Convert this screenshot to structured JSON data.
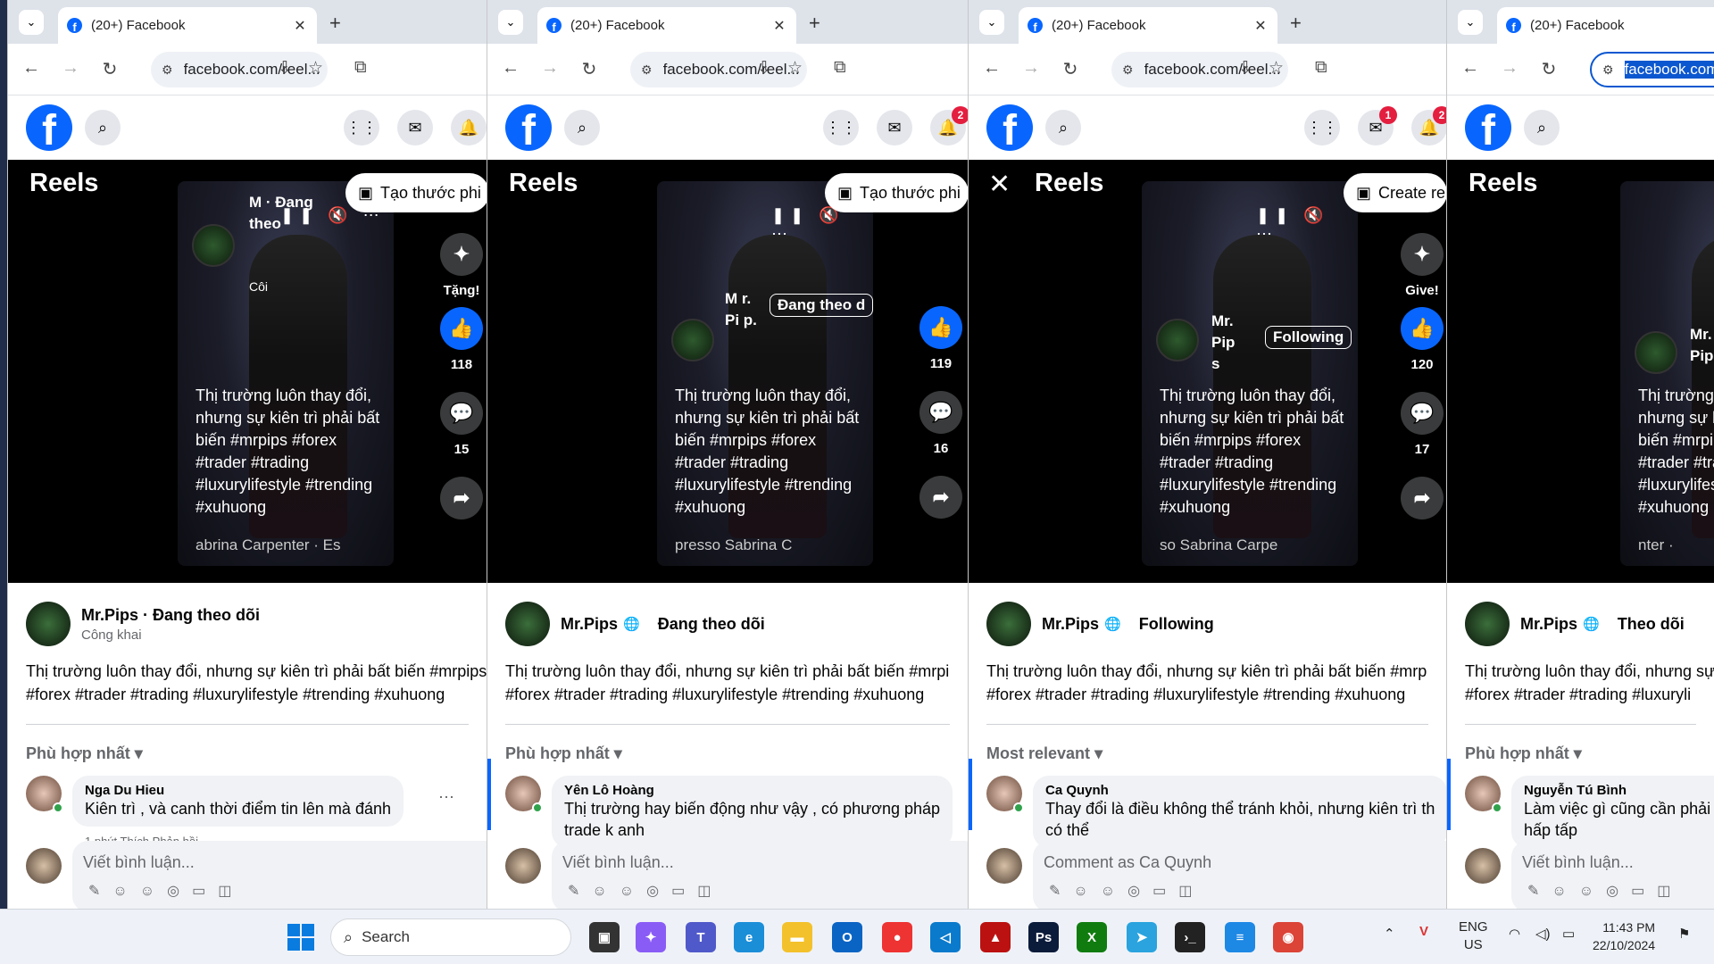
{
  "taskbar": {
    "search": "Search",
    "lang": "ENG",
    "region": "US",
    "time": "11:43 PM",
    "date": "22/10/2024"
  },
  "windows": [
    {
      "tab_title": "(20+) Facebook",
      "url": "facebook.com/reel...",
      "notif_badge": "",
      "msg_badge": "",
      "reels_label": "Reels",
      "create_label": "Tạo thước phi",
      "gift_label": "Tặng!",
      "likes": "118",
      "comments": "15",
      "author_overlay": "M · Đang theo",
      "privacy": "Côi",
      "follow_pill": "",
      "caption": "Thị trường luôn thay đổi, nhưng sự kiên trì phải bất biến #mrpips #forex #trader #trading #luxurylifestyle #trending #xuhuong",
      "audio": "abrina Carpenter · Es",
      "post_name": "Mr.Pips · Đang theo dõi",
      "post_follow": "",
      "post_sub": "Công khai",
      "post_line1": "Thị trường luôn thay đổi, nhưng sự kiên trì phải bất biến #mrpips",
      "post_line2": "#forex #trader #trading #luxurylifestyle #trending #xuhuong",
      "sort": "Phù hợp nhất",
      "c_name": "Nga Du Hieu",
      "c_text": "Kiên trì , và canh thời điểm tin lên mà đánh",
      "c_meta": "1 phút   Thích   Phản hồi",
      "write": "Viết bình luận..."
    },
    {
      "tab_title": "(20+) Facebook",
      "url": "facebook.com/reel...",
      "notif_badge": "2",
      "msg_badge": "",
      "reels_label": "Reels",
      "create_label": "Tạo thước phi",
      "gift_label": "",
      "likes": "119",
      "comments": "16",
      "author_overlay": "M r. Pi p.",
      "privacy": "",
      "follow_pill": "Đang theo d",
      "caption": "Thị trường luôn thay đổi, nhưng sự kiên trì phải bất biến #mrpips #forex #trader #trading #luxurylifestyle #trending #xuhuong",
      "audio": "presso      Sabrina C",
      "post_name": "Mr.Pips",
      "post_follow": "Đang theo dõi",
      "post_sub": "",
      "post_line1": "Thị trường luôn thay đổi, nhưng sự kiên trì phải bất biến #mrpi",
      "post_line2": "#forex #trader #trading #luxurylifestyle #trending #xuhuong",
      "sort": "Phù hợp nhất",
      "c_name": "Yên Lô Hoàng",
      "c_text": "Thị trường hay biến động như vậy , có phương pháp",
      "c_text2": "trade k anh",
      "c_meta": "",
      "write": "Viết bình luận..."
    },
    {
      "tab_title": "(20+) Facebook",
      "url": "facebook.com/reel...",
      "notif_badge": "2",
      "msg_badge": "1",
      "reels_label": "Reels",
      "create_label": "Create re",
      "gift_label": "Give!",
      "likes": "120",
      "comments": "17",
      "author_overlay": "Mr. Pip s",
      "privacy": "",
      "follow_pill": "Following",
      "caption": "Thị trường luôn thay đổi, nhưng sự kiên trì phải bất biến #mrpips #forex #trader #trading #luxurylifestyle #trending #xuhuong",
      "audio": "so      Sabrina Carpe",
      "post_name": "Mr.Pips",
      "post_follow": "Following",
      "post_sub": "",
      "post_line1": "Thị trường luôn thay đổi, nhưng sự kiên trì phải bất biến #mrp",
      "post_line2": "#forex #trader #trading #luxurylifestyle #trending #xuhuong",
      "sort": "Most relevant",
      "c_name": "Ca Quynh",
      "c_text": "Thay đổi là điều không thể tránh khỏi, nhưng kiên trì th",
      "c_text2": "có thể",
      "c_meta": "",
      "write": "Comment as Ca Quynh"
    },
    {
      "tab_title": "(20+) Facebook",
      "url": "facebook.com",
      "notif_badge": "",
      "msg_badge": "",
      "reels_label": "Reels",
      "create_label": "",
      "gift_label": "",
      "likes": "",
      "comments": "",
      "author_overlay": "Mr. Pips",
      "privacy": "",
      "follow_pill": "",
      "caption": "Thị trường luôn thay đổi, nhưng sự kiên trì phải bất biến #mrpips #forex #trader #trading #luxurylifestyle #trending #xuhuong",
      "audio": "nter ·",
      "post_name": "Mr.Pips",
      "post_follow": "Theo dõi",
      "post_sub": "",
      "post_line1": "Thị trường luôn thay đổi, nhưng sự",
      "post_line2": "#forex #trader #trading #luxuryli",
      "sort": "Phù hợp nhất",
      "c_name": "Nguyễn Tú Bình",
      "c_text": "Làm việc gì cũng cần phải",
      "c_text2": "hấp tấp",
      "c_meta": "",
      "write": "Viết bình luận..."
    }
  ]
}
